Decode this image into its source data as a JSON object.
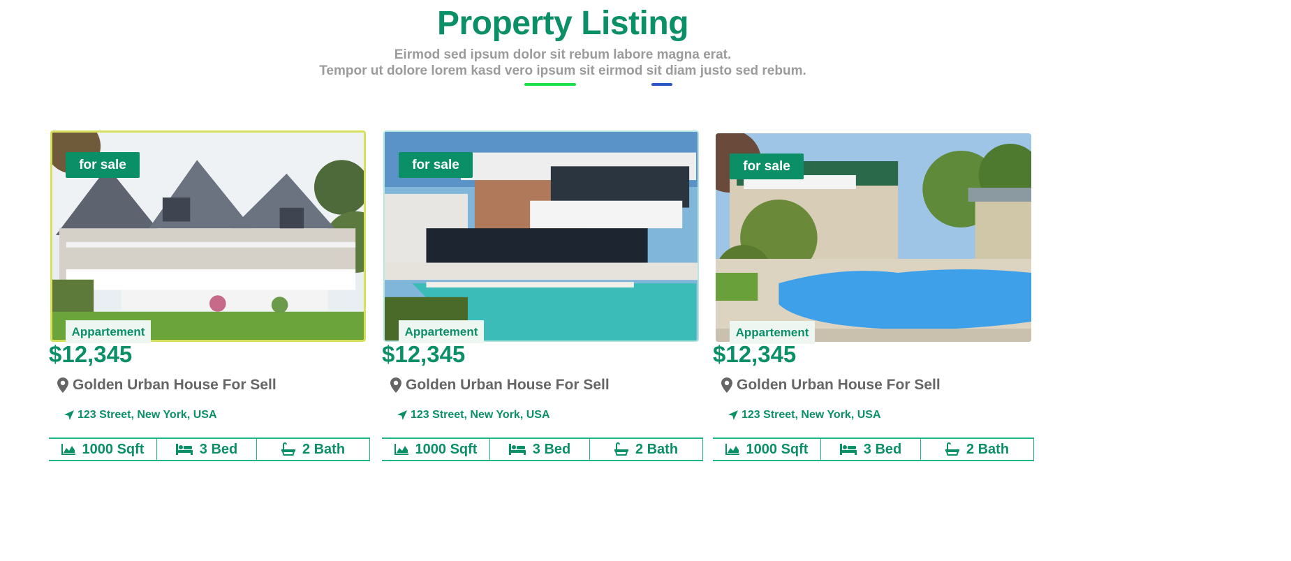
{
  "header": {
    "title": "Property Listing",
    "subtitle_line1": "Eirmod sed ipsum dolor sit rebum labore magna erat.",
    "subtitle_line2": "Tempor ut dolore lorem kasd vero ipsum sit eirmod sit diam justo sed rebum."
  },
  "colors": {
    "accent": "#0b8f67",
    "divider_green": "#1ee04a",
    "divider_blue": "#2a56c6"
  },
  "listings": [
    {
      "status": "for sale",
      "type": "Appartement",
      "price": "$12,345",
      "name": "Golden Urban House For Sell",
      "address": "123 Street, New York, USA",
      "area": "1000 Sqft",
      "beds": "3 Bed",
      "baths": "2 Bath",
      "image": "white-victorian-house-with-porch"
    },
    {
      "status": "for sale",
      "type": "Appartement",
      "price": "$12,345",
      "name": "Golden Urban House For Sell",
      "address": "123 Street, New York, USA",
      "area": "1000 Sqft",
      "beds": "3 Bed",
      "baths": "2 Bath",
      "image": "modern-house-with-pool"
    },
    {
      "status": "for sale",
      "type": "Appartement",
      "price": "$12,345",
      "name": "Golden Urban House For Sell",
      "address": "123 Street, New York, USA",
      "area": "1000 Sqft",
      "beds": "3 Bed",
      "baths": "2 Bath",
      "image": "house-with-backyard-pool"
    }
  ],
  "icons": {
    "location": "map-marker-icon",
    "address": "location-arrow-icon",
    "area": "area-chart-icon",
    "beds": "bed-icon",
    "baths": "bath-icon"
  }
}
